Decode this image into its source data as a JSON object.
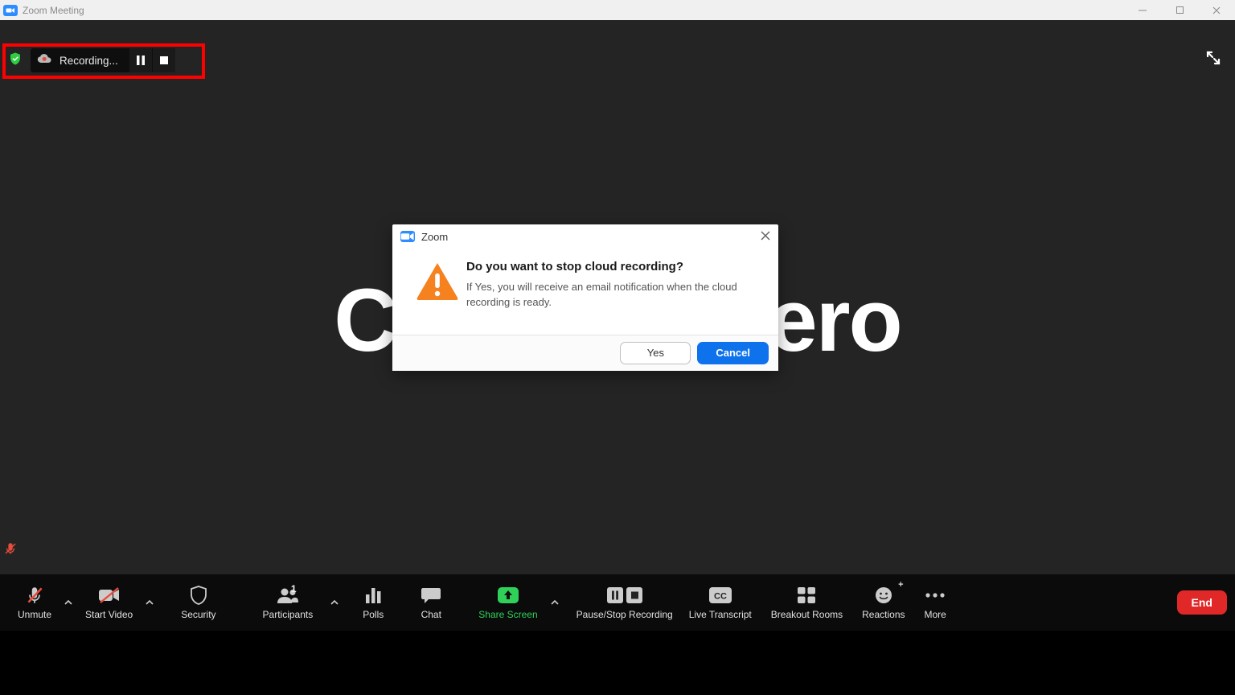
{
  "window": {
    "title": "Zoom Meeting"
  },
  "recording": {
    "label": "Recording..."
  },
  "participant": {
    "display_name": "Cristina Otero"
  },
  "dialog": {
    "app": "Zoom",
    "heading": "Do you want to stop cloud recording?",
    "body": "If Yes, you will receive an email notification when the cloud recording is ready.",
    "yes": "Yes",
    "cancel": "Cancel"
  },
  "toolbar": {
    "unmute": "Unmute",
    "start_video": "Start Video",
    "security": "Security",
    "participants": "Participants",
    "participants_count": "1",
    "polls": "Polls",
    "chat": "Chat",
    "share_screen": "Share Screen",
    "record": "Pause/Stop Recording",
    "transcript": "Live Transcript",
    "breakout": "Breakout Rooms",
    "reactions": "Reactions",
    "more": "More",
    "end": "End"
  }
}
